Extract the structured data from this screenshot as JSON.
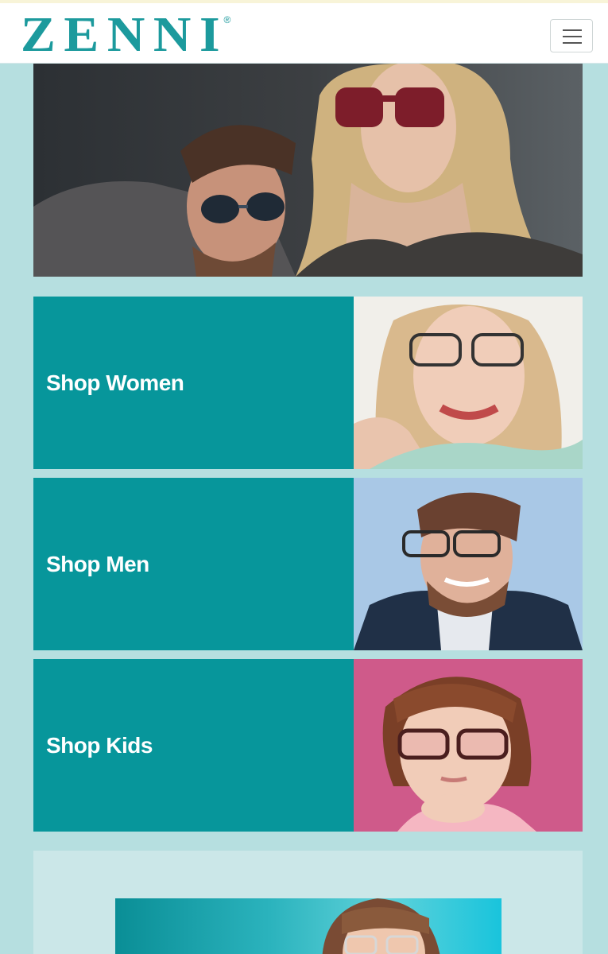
{
  "header": {
    "logo_text": "ZENNI",
    "logo_mark": "®",
    "menu_icon": "hamburger-menu-icon"
  },
  "hero": {
    "image": "couple-wearing-sunglasses-photo"
  },
  "shop_cards": [
    {
      "label": "Shop Women",
      "image": "woman-wearing-glasses-photo"
    },
    {
      "label": "Shop Men",
      "image": "man-wearing-glasses-photo"
    },
    {
      "label": "Shop Kids",
      "image": "girl-wearing-glasses-photo"
    }
  ],
  "promo": {
    "image": "woman-with-glasses-teal-banner-photo"
  },
  "colors": {
    "brand_teal": "#07969b",
    "page_bg": "#b6dfe0",
    "logo": "#1c9a9d"
  }
}
